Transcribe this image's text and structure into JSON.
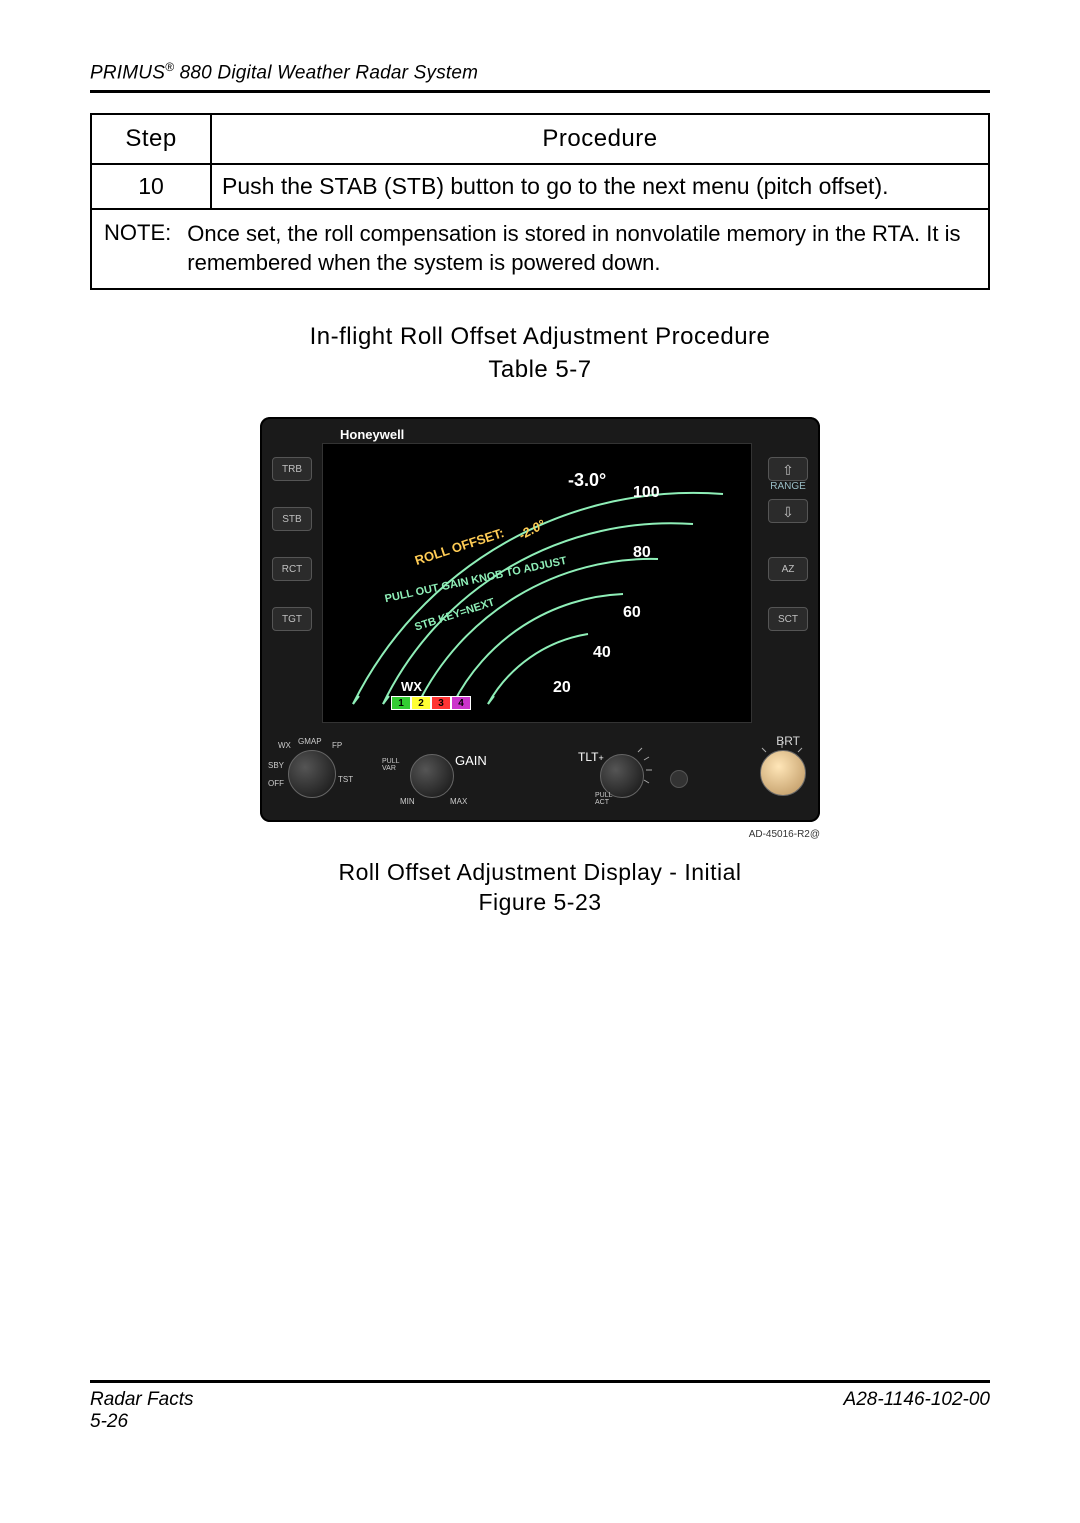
{
  "header": {
    "title_pre": "PRIMUS",
    "title_sup": "®",
    "title_post": " 880 Digital Weather Radar System"
  },
  "table": {
    "headers": {
      "step": "Step",
      "procedure": "Procedure"
    },
    "rows": [
      {
        "step": "10",
        "procedure": "Push the STAB (STB) button to go to the next menu (pitch offset)."
      }
    ],
    "note_label": "NOTE:",
    "note_text": "Once set, the roll compensation is stored in nonvolatile memory in the RTA. It is remembered when the system is powered down."
  },
  "table_caption": {
    "line1": "In-flight Roll Offset Adjustment Procedure",
    "line2": "Table 5-7"
  },
  "radar": {
    "brand": "Honeywell",
    "left_buttons": [
      "TRB",
      "STB",
      "RCT",
      "TGT"
    ],
    "right_buttons_arrows": [
      "⇧",
      "⇩"
    ],
    "right_buttons": [
      "AZ",
      "SCT"
    ],
    "range_label": "RANGE",
    "tilt_value": "-3.0°",
    "range_marks": [
      "100",
      "80",
      "60",
      "40",
      "20"
    ],
    "curved_line1": "ROLL OFFSET:",
    "curved_value": "-2.0°",
    "curved_line2": "PULL OUT GAIN KNOB TO ADJUST",
    "curved_line3": "STB KEY=NEXT",
    "wx_label": "WX",
    "wx_nums": [
      "1",
      "2",
      "3",
      "4"
    ],
    "wx_colors": [
      "#33cc33",
      "#ffff33",
      "#ff3333",
      "#cc33cc"
    ],
    "mode_labels": [
      "WX",
      "GMAP",
      "FP",
      "SBY",
      "OFF",
      "TST"
    ],
    "gain_label": "GAIN",
    "gain_min": "MIN",
    "gain_max": "MAX",
    "gain_pull": "PULL\\nVAR",
    "tilt_label": "TLT",
    "tilt_pull": "PULL\\nACT",
    "brt_label": "BRT",
    "fig_id": "AD-45016-R2@"
  },
  "figure_caption": {
    "line1": "Roll Offset Adjustment Display - Initial",
    "line2": "Figure 5-23"
  },
  "footer": {
    "left": "Radar Facts",
    "page": "5-26",
    "right": "A28-1146-102-00"
  }
}
